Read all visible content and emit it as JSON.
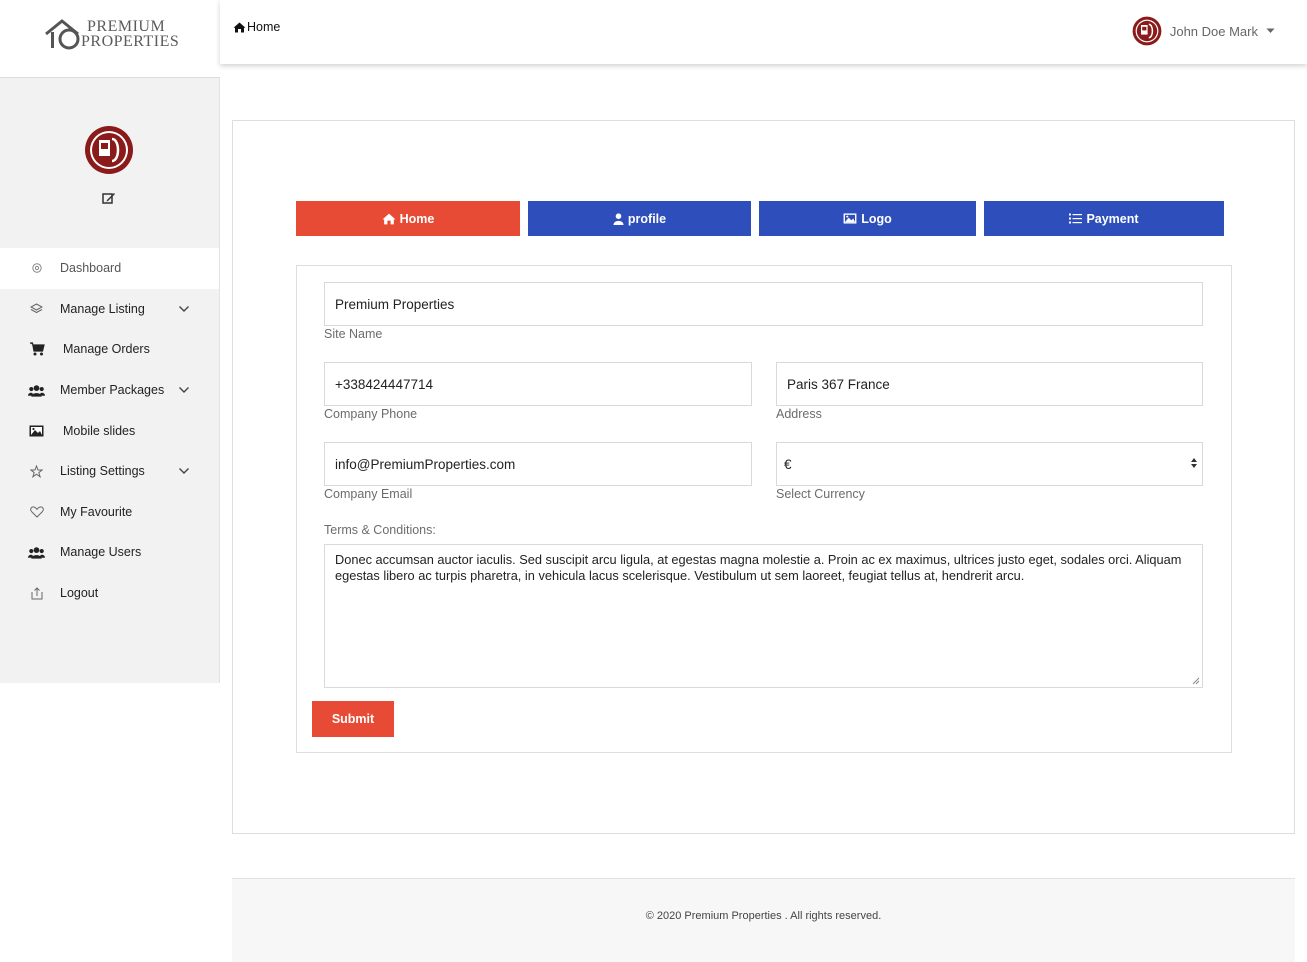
{
  "brand": {
    "line1": "Premium",
    "line2": "Properties"
  },
  "sidebar": {
    "items": [
      {
        "label": "Dashboard",
        "icon": "gear-icon"
      },
      {
        "label": "Manage Listing",
        "icon": "layers-icon"
      },
      {
        "label": "Manage Orders",
        "icon": "cart-icon"
      },
      {
        "label": "Member Packages",
        "icon": "users-icon"
      },
      {
        "label": "Mobile slides",
        "icon": "image-icon"
      },
      {
        "label": "Listing Settings",
        "icon": "star-icon"
      },
      {
        "label": "My Favourite",
        "icon": "heart-icon"
      },
      {
        "label": "Manage Users",
        "icon": "users-icon"
      },
      {
        "label": "Logout",
        "icon": "logout-icon"
      }
    ]
  },
  "header": {
    "breadcrumb": "Home",
    "user_name": "John Doe Mark"
  },
  "tabs": {
    "home": "Home",
    "profile": "profile",
    "logo": "Logo",
    "payment": "Payment"
  },
  "form": {
    "site_name": {
      "value": "Premium Properties",
      "label": "Site Name"
    },
    "phone": {
      "value": "+338424447714",
      "label": "Company Phone"
    },
    "address": {
      "value": "Paris  367 France",
      "label": "Address"
    },
    "email": {
      "value": "info@PremiumProperties.com",
      "label": "Company Email"
    },
    "currency": {
      "value": "€",
      "label": "Select Currency"
    },
    "terms": {
      "label": "Terms & Conditions:",
      "value": "Donec accumsan auctor iaculis. Sed suscipit arcu ligula, at egestas magna molestie a. Proin ac ex maximus, ultrices justo eget, sodales orci. Aliquam egestas libero ac turpis pharetra, in vehicula lacus scelerisque. Vestibulum ut sem laoreet, feugiat tellus at, hendrerit arcu."
    },
    "submit": "Submit"
  },
  "footer": {
    "text": "© 2020 Premium Properties . All rights reserved."
  },
  "colors": {
    "accent": "#e84b35",
    "primary": "#2e4fbb",
    "avatar": "#8b1a1a"
  }
}
